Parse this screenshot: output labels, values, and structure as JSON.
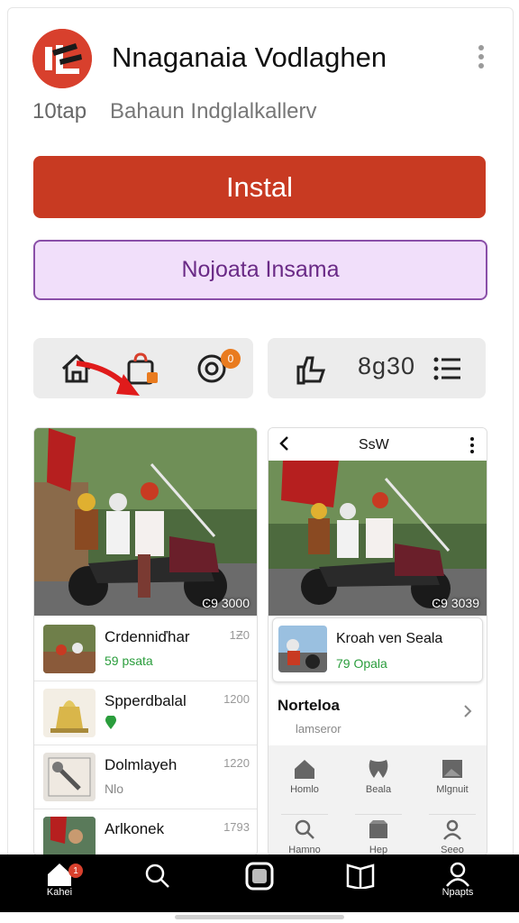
{
  "app": {
    "title": "Nnaganaia Vodlaghen",
    "meta_left": "10tap",
    "meta_right": "Bahaun Indglalkallerv"
  },
  "actions": {
    "install_label": "Instal",
    "secondary_label": "Nojoata Insama"
  },
  "toolbar_left": {
    "badge": "0"
  },
  "toolbar_right": {
    "glyph_text": "8ɡ30"
  },
  "left_card": {
    "counter": "Ͼ9 3000",
    "items": [
      {
        "title": "Crdenniďhar",
        "sub": "59 psata",
        "time": "1Ƶ0"
      },
      {
        "title": "Spperdbalal",
        "sub": "",
        "time": "1200"
      },
      {
        "title": "Dolmlayeh",
        "sub": "Nlo",
        "time": "1220"
      },
      {
        "title": "Arlkonek",
        "sub": "",
        "time": "1793"
      }
    ]
  },
  "right_card": {
    "header": "SsW",
    "counter": "Ͼ9 3039",
    "feature": {
      "title": "Kroah ven Seala",
      "sub": "79 Opala"
    },
    "section_title": "Norteloa",
    "section_sub": "lamseror",
    "grid": [
      {
        "label": "Homlo",
        "icon": "home-icon"
      },
      {
        "label": "Beala",
        "icon": "tooth-icon"
      },
      {
        "label": "Mlgnuit",
        "icon": "image-icon"
      },
      {
        "label": "Hamno",
        "icon": "search-icon"
      },
      {
        "label": "Hep",
        "icon": "store-icon"
      },
      {
        "label": "Seeo",
        "icon": "person-icon"
      }
    ]
  },
  "bottom_nav": {
    "items": [
      {
        "label": "Kahei",
        "icon": "home-icon",
        "badge": "1"
      },
      {
        "label": "",
        "icon": "search-icon"
      },
      {
        "label": "",
        "icon": "square-icon"
      },
      {
        "label": "",
        "icon": "book-icon"
      },
      {
        "label": "Npapts",
        "icon": "person-icon"
      }
    ]
  },
  "colors": {
    "install_red": "#c83a22",
    "secondary_purple": "#8a4fa8",
    "green": "#2a9d3c"
  }
}
